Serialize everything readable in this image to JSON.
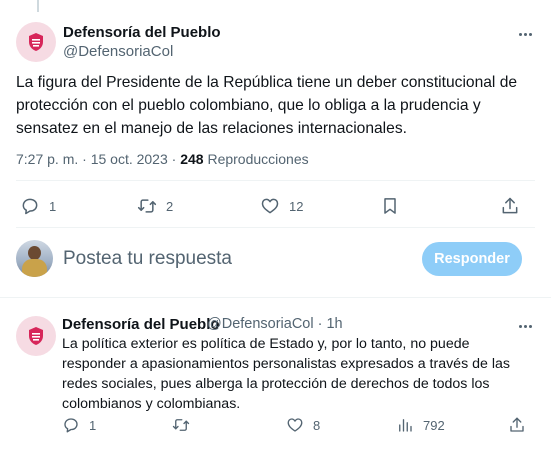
{
  "main_tweet": {
    "author_name": "Defensoría del Pueblo",
    "author_handle": "@DefensoriaCol",
    "text": "La figura del Presidente de la República tiene un deber constitucional de protección con el pueblo colombiano, que lo obliga a la prudencia y sensatez en el manejo de las relaciones internacionales.",
    "timestamp": "7:27 p. m. · 15 oct. 2023 · ",
    "views_count": "248",
    "views_label": " Reproducciones",
    "actions": {
      "replies": "1",
      "retweets": "2",
      "likes": "12"
    }
  },
  "composer": {
    "placeholder": "Postea tu respuesta",
    "button_label": "Responder"
  },
  "reply_tweet": {
    "author_name": "Defensoría del Pueblo",
    "handle_time": "@DefensoriaCol · 1h",
    "text": "La política exterior es política de Estado y, por lo tanto, no puede responder a apasionamientos personalistas expresados a través de las redes sociales, pues alberga la protección de derechos de todos los colombianos y colombianas.",
    "actions": {
      "replies": "1",
      "likes": "8",
      "views": "792"
    }
  },
  "icons": [
    "reply-icon",
    "retweet-icon",
    "like-icon",
    "bookmark-icon",
    "share-icon",
    "views-icon",
    "more-icon"
  ],
  "colors": {
    "text_primary": "#0f1419",
    "text_secondary": "#536471",
    "button_disabled": "#8ecdf8",
    "divider": "#eff3f4"
  }
}
